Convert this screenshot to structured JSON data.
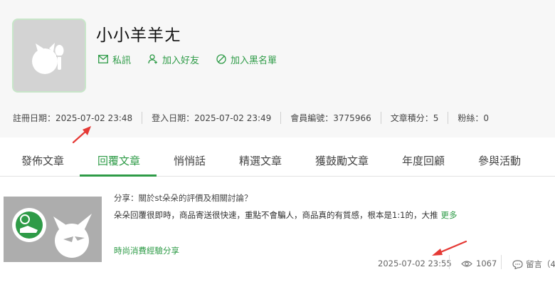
{
  "profile": {
    "username": "小小羊羊ㄤ",
    "actions": [
      {
        "label": "私訊",
        "icon": "mail-icon"
      },
      {
        "label": "加入好友",
        "icon": "add-friend-icon"
      },
      {
        "label": "加入黑名單",
        "icon": "block-icon"
      }
    ],
    "stats": [
      "註冊日期：2025-07-02 23:48",
      "登入日期：2025-07-02 23:49",
      "會員編號：3775966",
      "文章積分：5",
      "粉絲：0"
    ]
  },
  "tabs": [
    {
      "label": "發佈文章",
      "active": false
    },
    {
      "label": "回覆文章",
      "active": true
    },
    {
      "label": "悄悄話",
      "active": false
    },
    {
      "label": "精選文章",
      "active": false
    },
    {
      "label": "獲鼓勵文章",
      "active": false
    },
    {
      "label": "年度回顧",
      "active": false
    },
    {
      "label": "參與活動",
      "active": false
    }
  ],
  "post": {
    "title": "分享：關於st朵朵的評價及相關討論？",
    "body": "朵朵回覆很即時，商品寄送很快速，重點不會騙人，商品真的有質感，根本是1:1的，大推",
    "more": "更多",
    "category": "時尚消費經驗分享",
    "timestamp": "2025-07-02 23:55",
    "views": "1067",
    "comments": "留言（4"
  },
  "colors": {
    "accent": "#2e9b47",
    "annotation_arrow": "#e53935"
  }
}
